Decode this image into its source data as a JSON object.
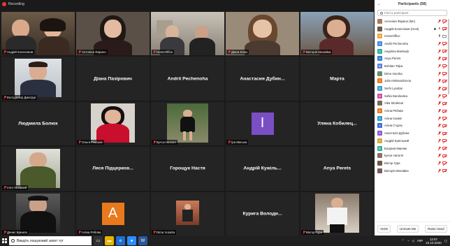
{
  "window": {
    "recording_label": "Recording"
  },
  "gallery": {
    "tiles": [
      {
        "kind": "video",
        "label": "Андрій Колесніков",
        "video": "two-people"
      },
      {
        "kind": "video",
        "label": "Антоніна Фарион",
        "video": "woman-dark"
      },
      {
        "kind": "video",
        "label": "HomeOffice",
        "video": "two-men-room",
        "active": true
      },
      {
        "kind": "video",
        "label": "Діана Кліко",
        "video": "woman-brown"
      },
      {
        "kind": "video",
        "label": "Вікторія Малайка",
        "video": "woman-outdoor"
      },
      {
        "kind": "video",
        "label": "Володимир Дмитрук",
        "video": "man-light"
      },
      {
        "kind": "name",
        "center": "Діана Пазірович"
      },
      {
        "kind": "name",
        "center": "Andrii Pechenoha"
      },
      {
        "kind": "name",
        "center": "Анастасия Дубин..."
      },
      {
        "kind": "name",
        "center": "Марта"
      },
      {
        "kind": "name",
        "center": "Людмила Болюх"
      },
      {
        "kind": "video",
        "label": "Ольга Ракська",
        "video": "woman-red"
      },
      {
        "kind": "video",
        "label": "Бучок Наталя",
        "video": "girl-outdoor"
      },
      {
        "kind": "letter",
        "label": "Іра Миська",
        "letter": "I",
        "color": "#7a4fc4"
      },
      {
        "kind": "name",
        "center": "Уляна Кобилец..."
      },
      {
        "kind": "video",
        "label": "Ілля Лісківкий",
        "video": "man-green"
      },
      {
        "kind": "name",
        "center": "Леся Підцерков..."
      },
      {
        "kind": "name",
        "center": "Горощук Настя"
      },
      {
        "kind": "name",
        "center": "Андрій Кужіль..."
      },
      {
        "kind": "name",
        "center": "Anya Perets"
      },
      {
        "kind": "video",
        "label": "Денис Бреиля",
        "video": "man-dark"
      },
      {
        "kind": "letter",
        "label": "Аліна Рябова",
        "letter": "A",
        "color": "#e8791c"
      },
      {
        "kind": "video",
        "label": "Dima Vuiurka",
        "video": "small-figure"
      },
      {
        "kind": "name",
        "center": "Курига Володи..."
      },
      {
        "kind": "video",
        "label": "Віктор Гури",
        "video": "man-white"
      }
    ]
  },
  "participants": {
    "title": "Participants (58)",
    "search_placeholder": "Find a participant",
    "items": [
      {
        "name": "Антоніна Фарион (Me)",
        "color": "#a87b5a",
        "mic": "off",
        "cam": "off"
      },
      {
        "name": "Андрій Колесніков (Host)",
        "color": "#6a5a4a",
        "mic": "on",
        "cam": "off",
        "extra": true
      },
      {
        "name": "HomeOffice",
        "color": "#f2a33a",
        "initial": "H",
        "mic": "on",
        "cam": "on"
      },
      {
        "name": "Andrii Pechenoha",
        "color": "#4a8bd6",
        "initial": "A",
        "mic": "off",
        "cam": "off"
      },
      {
        "name": "Angelina Martseyk",
        "color": "#2db09b",
        "initial": "A",
        "mic": "off",
        "cam": "off"
      },
      {
        "name": "Anya Perets",
        "color": "#2d7fd6",
        "initial": "A",
        "mic": "off",
        "cam": "off"
      },
      {
        "name": "Bohdan Tolpa",
        "color": "#5a7fd6",
        "initial": "B",
        "mic": "off",
        "cam": "off"
      },
      {
        "name": "Dima Vuiurka",
        "color": "#6b8c6b",
        "mic": "off",
        "cam": "off"
      },
      {
        "name": "Julia Aleksandrovna",
        "color": "#e8791c",
        "initial": "J",
        "mic": "off",
        "cam": "off"
      },
      {
        "name": "Serhi Lysobai",
        "color": "#3a9bd6",
        "initial": "S",
        "mic": "off",
        "cam": "off"
      },
      {
        "name": "Sofiia Danilovska",
        "color": "#c94fa4",
        "initial": "S",
        "mic": "off",
        "cam": "off"
      },
      {
        "name": "Vika Sitnikmal",
        "color": "#7a6a5a",
        "mic": "off",
        "cam": "off"
      },
      {
        "name": "Аліна Рябова",
        "color": "#e8791c",
        "initial": "А",
        "mic": "off",
        "cam": "off"
      },
      {
        "name": "Аліна Скиків",
        "color": "#2d9bd6",
        "initial": "А",
        "mic": "off",
        "cam": "off"
      },
      {
        "name": "Аліна Стурчь",
        "color": "#3a6bd6",
        "initial": "А",
        "mic": "off",
        "cam": "off"
      },
      {
        "name": "Анастасія Дубина",
        "color": "#8a5ad6",
        "initial": "А",
        "mic": "off",
        "cam": "off"
      },
      {
        "name": "Андрій Кужільний",
        "color": "#d6a33a",
        "initial": "А",
        "mic": "off",
        "cam": "off"
      },
      {
        "name": "Богдана Мирчик",
        "color": "#2db09b",
        "initial": "Б",
        "mic": "off",
        "cam": "off"
      },
      {
        "name": "Бучок Наталя",
        "color": "#8a7060",
        "mic": "off",
        "cam": "off"
      },
      {
        "name": "Віктор Гури",
        "color": "#6a5a4a",
        "mic": "off",
        "cam": "off"
      },
      {
        "name": "Вікторія Малайка",
        "color": "#7a5a5a",
        "mic": "off",
        "cam": "off"
      }
    ],
    "buttons": {
      "invite": "Invite",
      "unmute": "Unmute Me",
      "raise": "Raise Hand"
    }
  },
  "taskbar": {
    "search_placeholder": "Введіть пошуковий запит тут",
    "language": "УКР",
    "time": "12:57",
    "date": "23.10.2020"
  }
}
